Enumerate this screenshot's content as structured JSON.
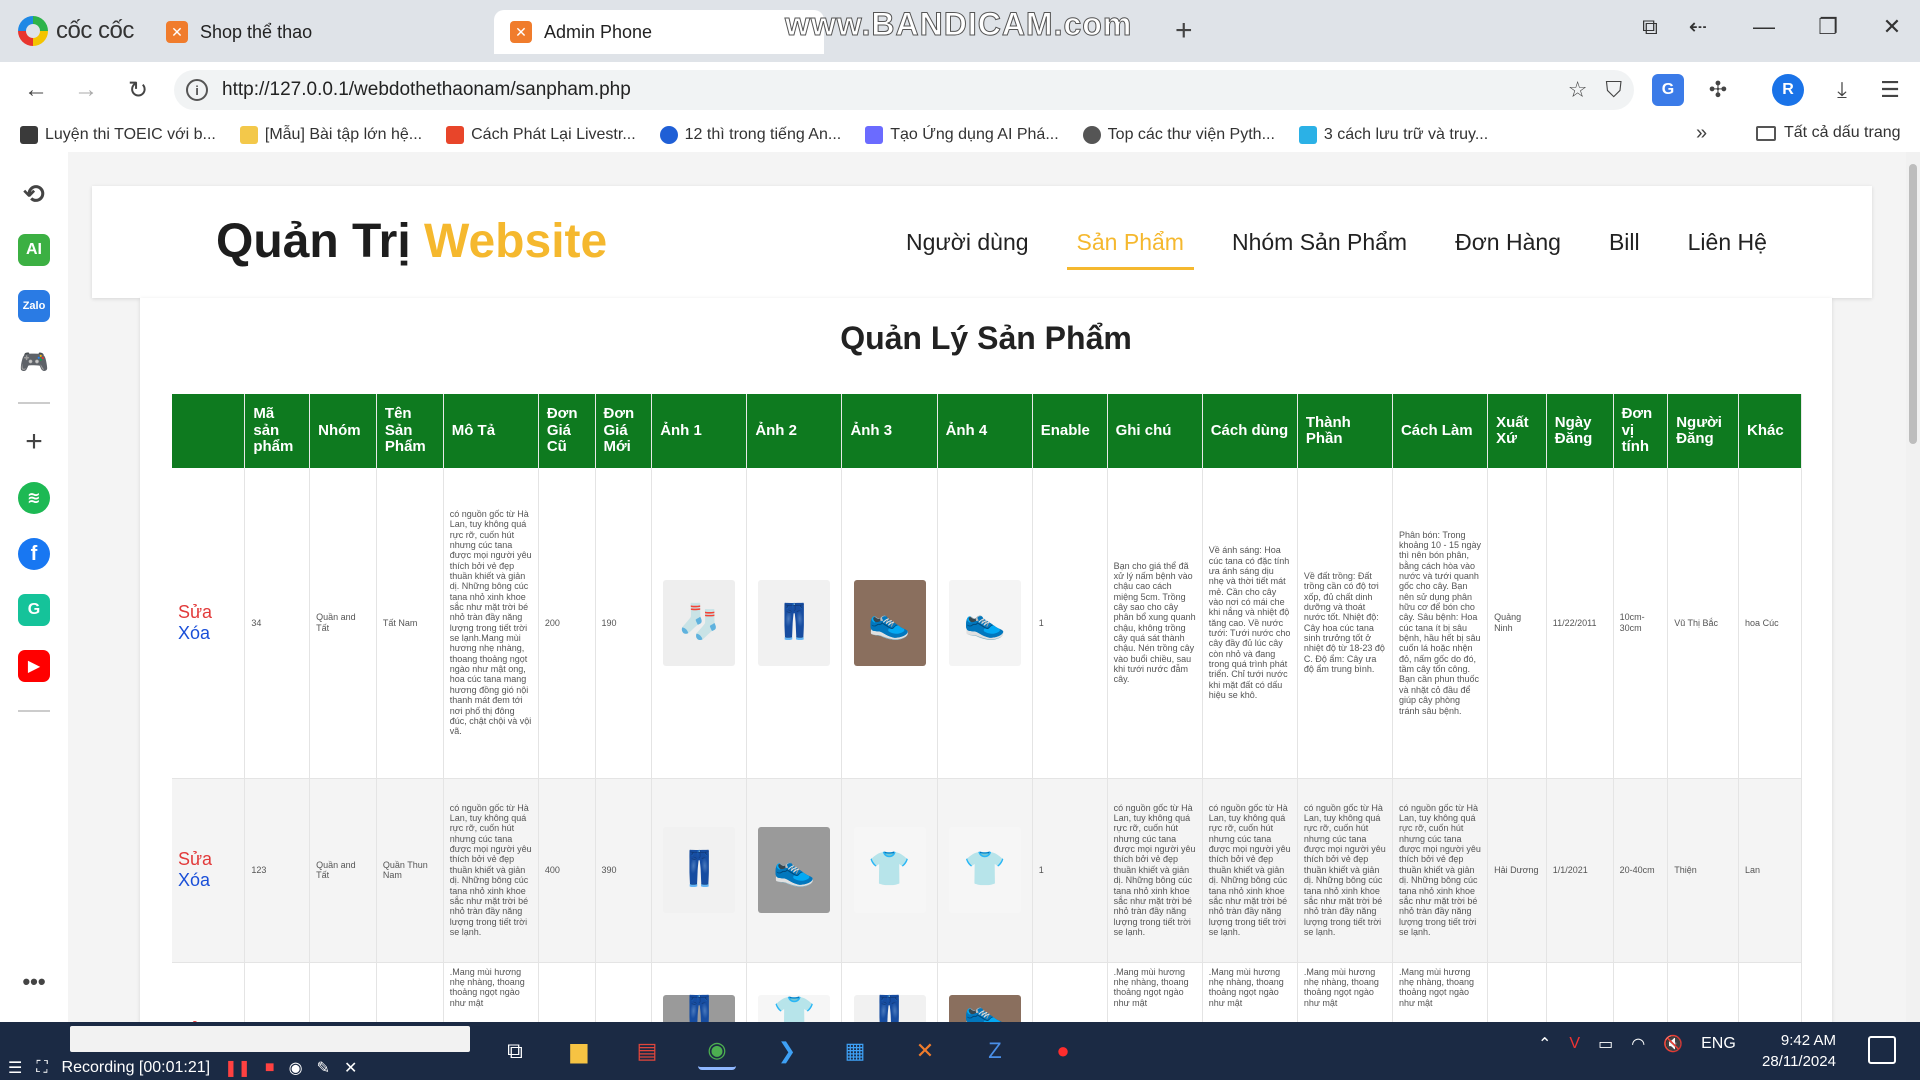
{
  "browser": {
    "brand": "cốc cốc",
    "tabs": [
      {
        "title": "Shop thể thao",
        "active": false
      },
      {
        "title": "Admin Phone",
        "active": true
      }
    ],
    "watermark": "www.BANDICAM.com",
    "url": "http://127.0.0.1/webdothethaonam/sanpham.php",
    "bookmarks": [
      {
        "label": "Luyện thi TOEIC với b...",
        "color": "#3a3a3a"
      },
      {
        "label": "[Mẫu] Bài tập lớn hệ...",
        "color": "#f3c84a"
      },
      {
        "label": "Cách Phát Lại Livestr...",
        "color": "#e8452a"
      },
      {
        "label": "12 thì trong tiếng An...",
        "color": "#1f5fd6"
      },
      {
        "label": "Tạo Ứng dụng AI Phá...",
        "color": "#6b6bff"
      },
      {
        "label": "Top các thư viện Pyth...",
        "color": "#555555"
      },
      {
        "label": "3 cách lưu trữ và truy...",
        "color": "#2bb1e6"
      }
    ],
    "all_bookmarks": "Tất cả dấu trang",
    "profile_initial": "R"
  },
  "header": {
    "title_main": "Quản Trị",
    "title_accent": "Website",
    "accent_color": "#f5b82e",
    "menu": [
      {
        "label": "Người dùng",
        "active": false
      },
      {
        "label": "Sản Phẩm",
        "active": true
      },
      {
        "label": "Nhóm Sản Phẩm",
        "active": false
      },
      {
        "label": "Đơn Hàng",
        "active": false
      },
      {
        "label": "Bill",
        "active": false
      },
      {
        "label": "Liên Hệ",
        "active": false
      }
    ]
  },
  "panel": {
    "title": "Quản Lý Sản Phẩm",
    "header_color": "#0e7a1f",
    "columns": [
      "",
      "Mã sản phẩm",
      "Nhóm",
      "Tên Sản Phẩm",
      "Mô Tả",
      "Đơn Giá Cũ",
      "Đơn Giá Mới",
      "Ảnh 1",
      "Ảnh 2",
      "Ảnh 3",
      "Ảnh 4",
      "Enable",
      "Ghi chú",
      "Cách dùng",
      "Thành Phần",
      "Cách Làm",
      "Xuất Xứ",
      "Ngày Đăng",
      "Đơn vị tính",
      "Người Đăng",
      "Khác"
    ],
    "edit_label": "Sửa",
    "delete_label": "Xóa",
    "rows": [
      {
        "ma": "34",
        "nhom": "Quần and Tất",
        "ten": "Tất Nam",
        "mota": "có nguồn gốc từ Hà Lan, tuy không quá rực rỡ, cuốn hút nhưng cúc tana được mọi người yêu thích bởi vẻ đẹp thuần khiết và giản dị. Những bông cúc tana nhỏ xinh khoe sắc như mặt trời bé nhỏ tràn đầy năng lượng trong tiết trời se lạnh.Mang mùi hương nhẹ nhàng, thoang thoảng ngọt ngào như mật ong, hoa cúc tana mang hương đồng gió nội thanh mát đem tới nơi phố thị đông đúc, chật chội và vội vã.",
        "giacu": "200",
        "giamoi": "190",
        "anh": [
          "🧦",
          "👖",
          "👟",
          "👟"
        ],
        "enable": "1",
        "ghichu": "Bạn cho giá thể đã xử lý nấm bệnh vào chậu cao cách miệng 5cm. Trồng cây sao cho cây phân bổ xung quanh chậu, không trồng cây quá sát thành chậu. Nén trồng cây vào buổi chiều, sau khi tưới nước đẫm cây.",
        "cachdung": "Về ánh sáng: Hoa cúc tana có đặc tính ưa ánh sáng dịu nhẹ và thời tiết mát mẻ. Cần cho cây vào nơi có mái che khi nắng và nhiệt độ tăng cao. Về nước tưới: Tưới nước cho cây đầy đủ lúc cây còn nhỏ và đang trong quá trình phát triển. Chỉ tưới nước khi mặt đất có dấu hiệu se khô.",
        "thanhphan": "Về đất trồng: Đất trồng cần có độ tơi xốp, đủ chất dinh dưỡng và thoát nước tốt. Nhiệt độ: Cây hoa cúc tana sinh trưởng tốt ở nhiệt độ từ 18-23 độ C. Độ ẩm: Cây ưa độ ẩm trung bình.",
        "cachlam": "Phân bón: Trong khoảng 10 - 15 ngày thì nên bón phân, bằng cách hòa vào nước và tưới quanh gốc cho cây. Bạn nên sử dụng phân hữu cơ để bón cho cây. Sâu bệnh: Hoa cúc tana ít bị sâu bệnh, hầu hết bị sâu cuốn lá hoặc nhện đỏ, nấm gốc do đó, tầm cây tốn công. Bạn cần phun thuốc và nhặt cỏ đầu để giúp cây phòng tránh sâu bệnh.",
        "xuatxu": "Quảng Ninh",
        "ngaydang": "11/22/2011",
        "donvi": "10cm-30cm",
        "nguoidang": "Vũ Thị Bắc",
        "khac": "hoa Cúc"
      },
      {
        "ma": "123",
        "nhom": "Quần and Tất",
        "ten": "Quần Thun Nam",
        "mota": "có nguồn gốc từ Hà Lan, tuy không quá rực rỡ, cuốn hút nhưng cúc tana được mọi người yêu thích bởi vẻ đẹp thuần khiết và giản dị. Những bông cúc tana nhỏ xinh khoe sắc như mặt trời bé nhỏ tràn đầy năng lượng trong tiết trời se lạnh.",
        "giacu": "400",
        "giamoi": "390",
        "anh": [
          "👖",
          "👟",
          "👕",
          "👕"
        ],
        "enable": "1",
        "ghichu": "có nguồn gốc từ Hà Lan, tuy không quá rực rỡ, cuốn hút nhưng cúc tana được mọi người yêu thích bởi vẻ đẹp thuần khiết và giản dị. Những bông cúc tana nhỏ xinh khoe sắc như mặt trời bé nhỏ tràn đầy năng lượng trong tiết trời se lạnh.",
        "cachdung": "có nguồn gốc từ Hà Lan, tuy không quá rực rỡ, cuốn hút nhưng cúc tana được mọi người yêu thích bởi vẻ đẹp thuần khiết và giản dị. Những bông cúc tana nhỏ xinh khoe sắc như mặt trời bé nhỏ tràn đầy năng lượng trong tiết trời se lạnh.",
        "thanhphan": "có nguồn gốc từ Hà Lan, tuy không quá rực rỡ, cuốn hút nhưng cúc tana được mọi người yêu thích bởi vẻ đẹp thuần khiết và giản dị. Những bông cúc tana nhỏ xinh khoe sắc như mặt trời bé nhỏ tràn đầy năng lượng trong tiết trời se lạnh.",
        "cachlam": "có nguồn gốc từ Hà Lan, tuy không quá rực rỡ, cuốn hút nhưng cúc tana được mọi người yêu thích bởi vẻ đẹp thuần khiết và giản dị. Những bông cúc tana nhỏ xinh khoe sắc như mặt trời bé nhỏ tràn đầy năng lượng trong tiết trời se lạnh.",
        "xuatxu": "Hải Dương",
        "ngaydang": "1/1/2021",
        "donvi": "20-40cm",
        "nguoidang": "Thiện",
        "khac": "Lan"
      },
      {
        "ma": "",
        "nhom": "",
        "ten": "",
        "mota": ".Mang mùi hương nhẹ nhàng, thoang thoảng ngọt ngào như mật",
        "giacu": "",
        "giamoi": "",
        "anh": [
          "👖",
          "👕",
          "👖",
          "👟"
        ],
        "enable": "",
        "ghichu": ".Mang mùi hương nhẹ nhàng, thoang thoảng ngọt ngào như mật",
        "cachdung": ".Mang mùi hương nhẹ nhàng, thoang thoảng ngọt ngào như mật",
        "thanhphan": ".Mang mùi hương nhẹ nhàng, thoang thoảng ngọt ngào như mật",
        "cachlam": ".Mang mùi hương nhẹ nhàng, thoang thoảng ngọt ngào như mật",
        "xuatxu": "",
        "ngaydang": "",
        "donvi": "",
        "nguoidang": "",
        "khac": ""
      }
    ]
  },
  "taskbar": {
    "recording": "Recording [00:01:21]",
    "lang": "ENG",
    "time": "9:42 AM",
    "date": "28/11/2024"
  }
}
